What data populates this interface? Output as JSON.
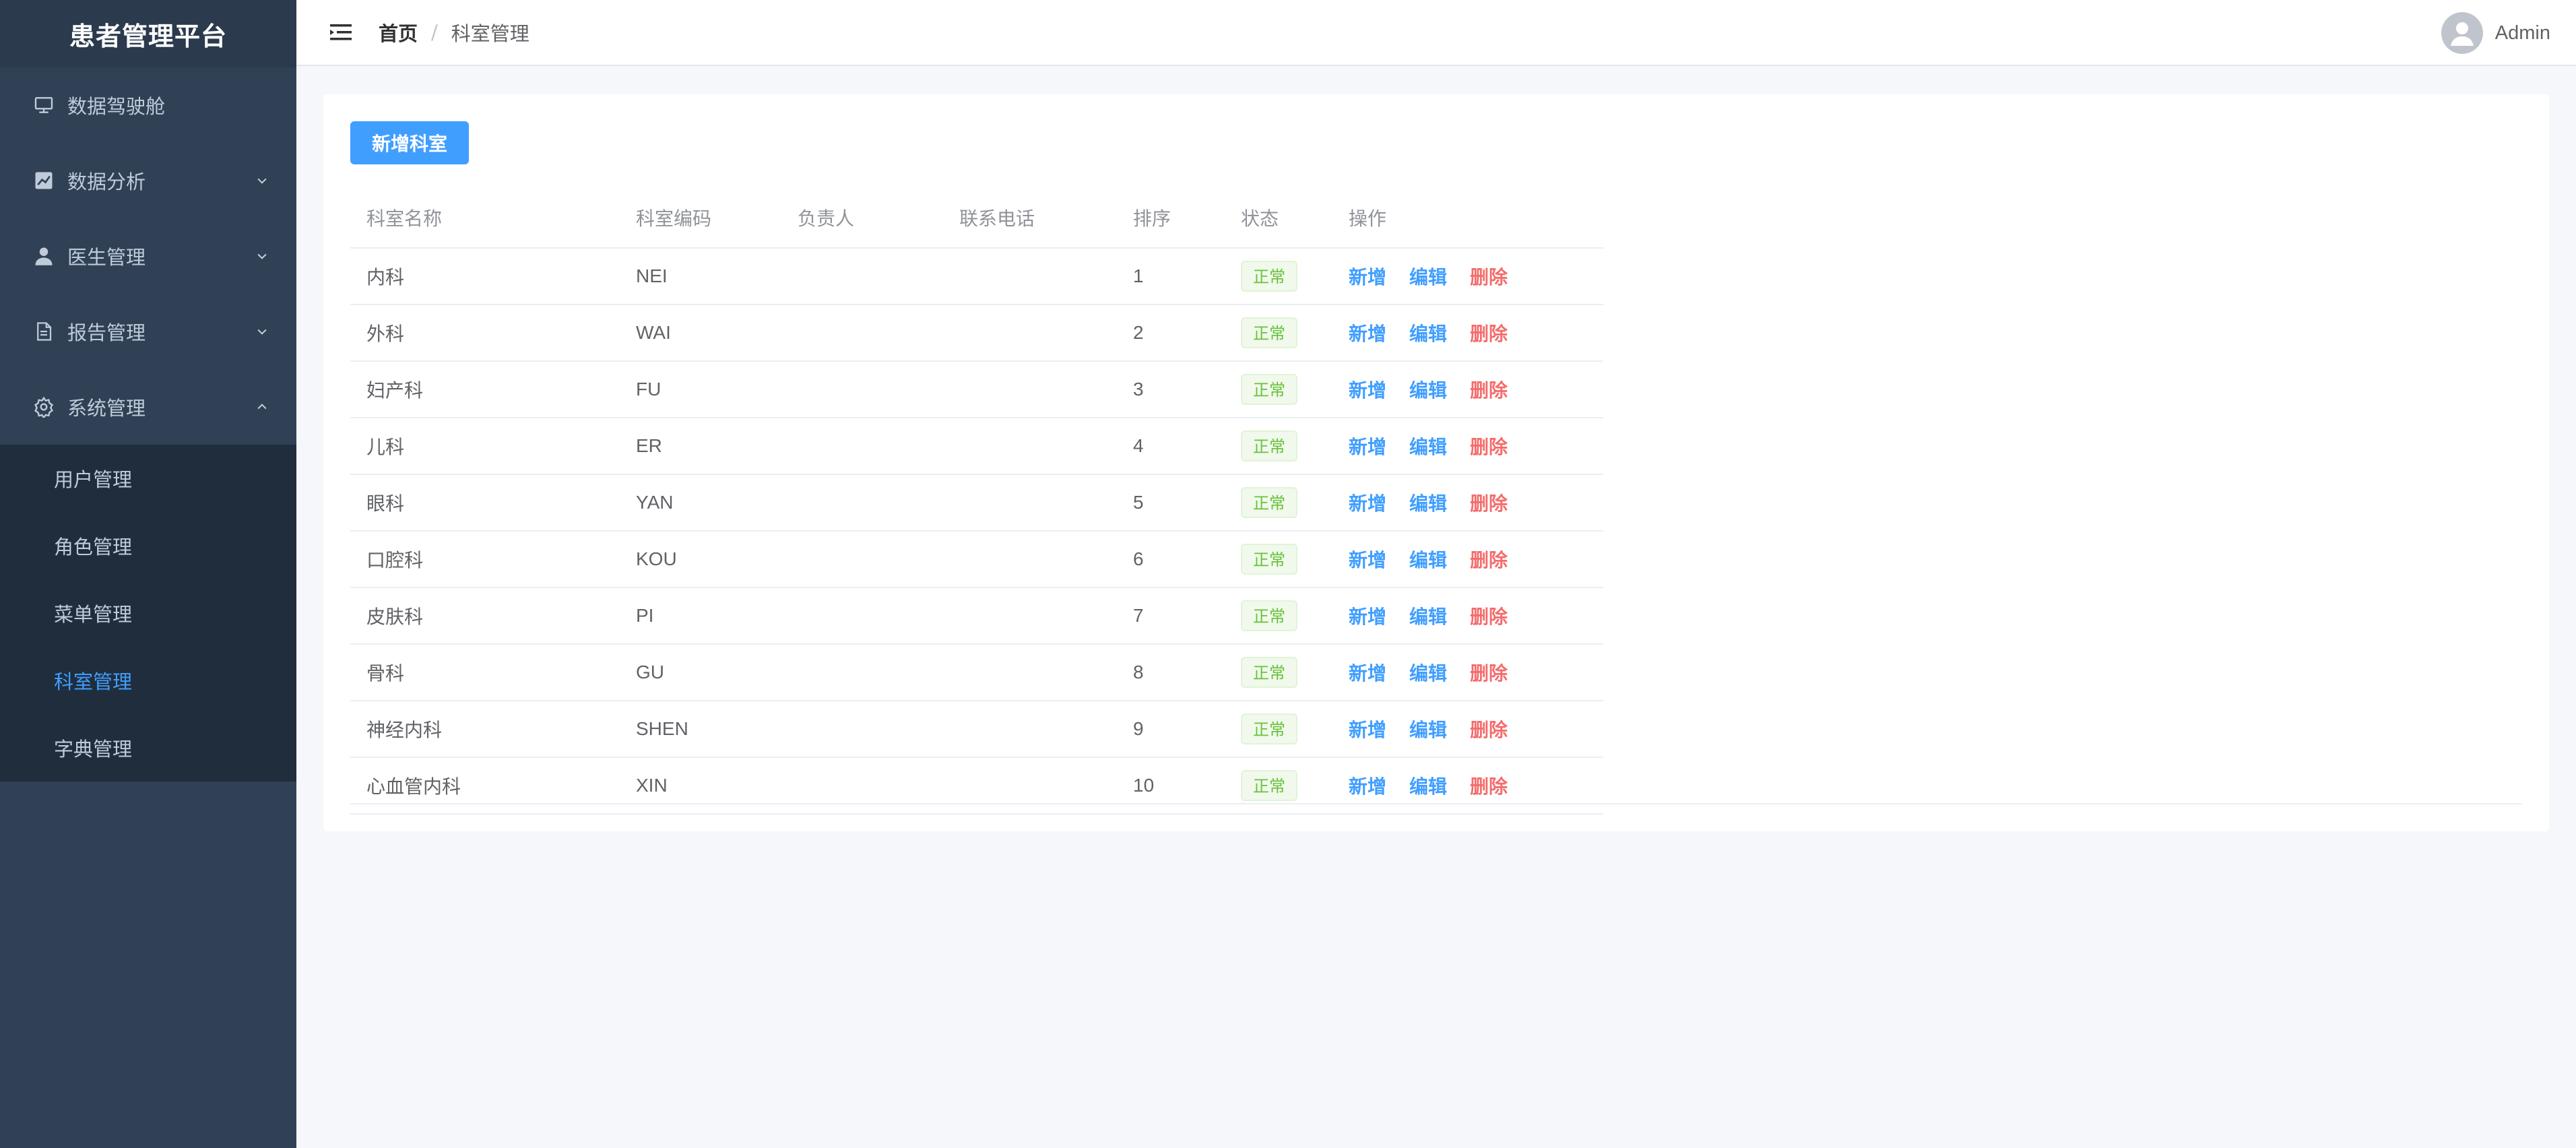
{
  "app": {
    "title": "患者管理平台"
  },
  "sidebar": {
    "items": [
      {
        "label": "数据驾驶舱",
        "icon": "dashboard-icon"
      },
      {
        "label": "数据分析",
        "icon": "chart-icon"
      },
      {
        "label": "医生管理",
        "icon": "user-icon"
      },
      {
        "label": "报告管理",
        "icon": "document-icon"
      },
      {
        "label": "系统管理",
        "icon": "gear-icon"
      }
    ],
    "submenu": [
      {
        "label": "用户管理"
      },
      {
        "label": "角色管理"
      },
      {
        "label": "菜单管理"
      },
      {
        "label": "科室管理"
      },
      {
        "label": "字典管理"
      }
    ]
  },
  "header": {
    "breadcrumb_home": "首页",
    "breadcrumb_sep": "/",
    "breadcrumb_current": "科室管理",
    "user": "Admin"
  },
  "toolbar": {
    "add_label": "新增科室"
  },
  "table": {
    "columns": [
      "科室名称",
      "科室编码",
      "负责人",
      "联系电话",
      "排序",
      "状态",
      "操作"
    ],
    "rows": [
      {
        "name": "内科",
        "code": "NEI",
        "leader": "",
        "phone": "",
        "sort": "1",
        "status": "正常"
      },
      {
        "name": "外科",
        "code": "WAI",
        "leader": "",
        "phone": "",
        "sort": "2",
        "status": "正常"
      },
      {
        "name": "妇产科",
        "code": "FU",
        "leader": "",
        "phone": "",
        "sort": "3",
        "status": "正常"
      },
      {
        "name": "儿科",
        "code": "ER",
        "leader": "",
        "phone": "",
        "sort": "4",
        "status": "正常"
      },
      {
        "name": "眼科",
        "code": "YAN",
        "leader": "",
        "phone": "",
        "sort": "5",
        "status": "正常"
      },
      {
        "name": "口腔科",
        "code": "KOU",
        "leader": "",
        "phone": "",
        "sort": "6",
        "status": "正常"
      },
      {
        "name": "皮肤科",
        "code": "PI",
        "leader": "",
        "phone": "",
        "sort": "7",
        "status": "正常"
      },
      {
        "name": "骨科",
        "code": "GU",
        "leader": "",
        "phone": "",
        "sort": "8",
        "status": "正常"
      },
      {
        "name": "神经内科",
        "code": "SHEN",
        "leader": "",
        "phone": "",
        "sort": "9",
        "status": "正常"
      },
      {
        "name": "心血管内科",
        "code": "XIN",
        "leader": "",
        "phone": "",
        "sort": "10",
        "status": "正常"
      }
    ],
    "actions": {
      "add": "新增",
      "edit": "编辑",
      "delete": "删除"
    }
  },
  "colors": {
    "accent": "#409eff",
    "danger": "#f56c6c",
    "success": "#67c23a",
    "sidebar": "#304156"
  }
}
